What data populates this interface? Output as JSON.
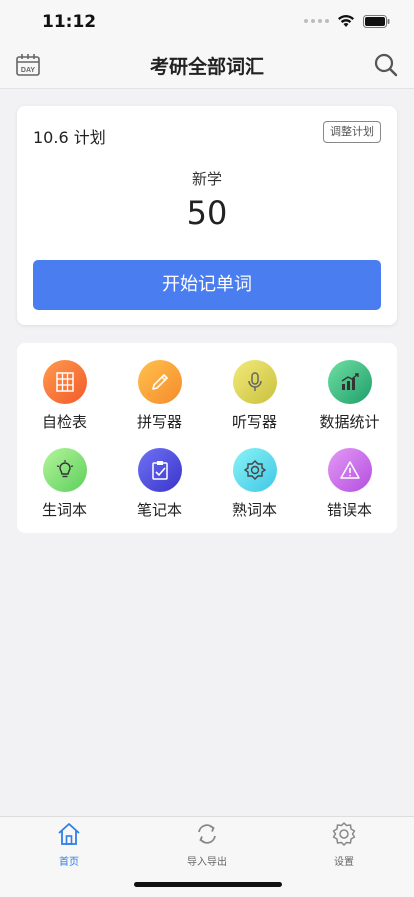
{
  "status": {
    "time": "11:12"
  },
  "nav": {
    "title": "考研全部词汇",
    "day_label": "DAY"
  },
  "plan": {
    "title": "10.6 计划",
    "adjust_label": "调整计划",
    "new_label": "新学",
    "new_count": "50",
    "start_label": "开始记单词"
  },
  "tools": [
    {
      "label": "自检表",
      "icon": "grid-icon"
    },
    {
      "label": "拼写器",
      "icon": "pencil-icon"
    },
    {
      "label": "听写器",
      "icon": "microphone-icon"
    },
    {
      "label": "数据统计",
      "icon": "chart-icon"
    },
    {
      "label": "生词本",
      "icon": "lightbulb-icon"
    },
    {
      "label": "笔记本",
      "icon": "clipboard-icon"
    },
    {
      "label": "熟词本",
      "icon": "gear-flower-icon"
    },
    {
      "label": "错误本",
      "icon": "warning-icon"
    }
  ],
  "tabs": [
    {
      "label": "首页",
      "icon": "home-icon",
      "active": true
    },
    {
      "label": "导入导出",
      "icon": "sync-icon",
      "active": false
    },
    {
      "label": "设置",
      "icon": "gear-icon",
      "active": false
    }
  ],
  "colors": {
    "accent": "#4a7ef0",
    "tab_active": "#2f7ee8"
  }
}
